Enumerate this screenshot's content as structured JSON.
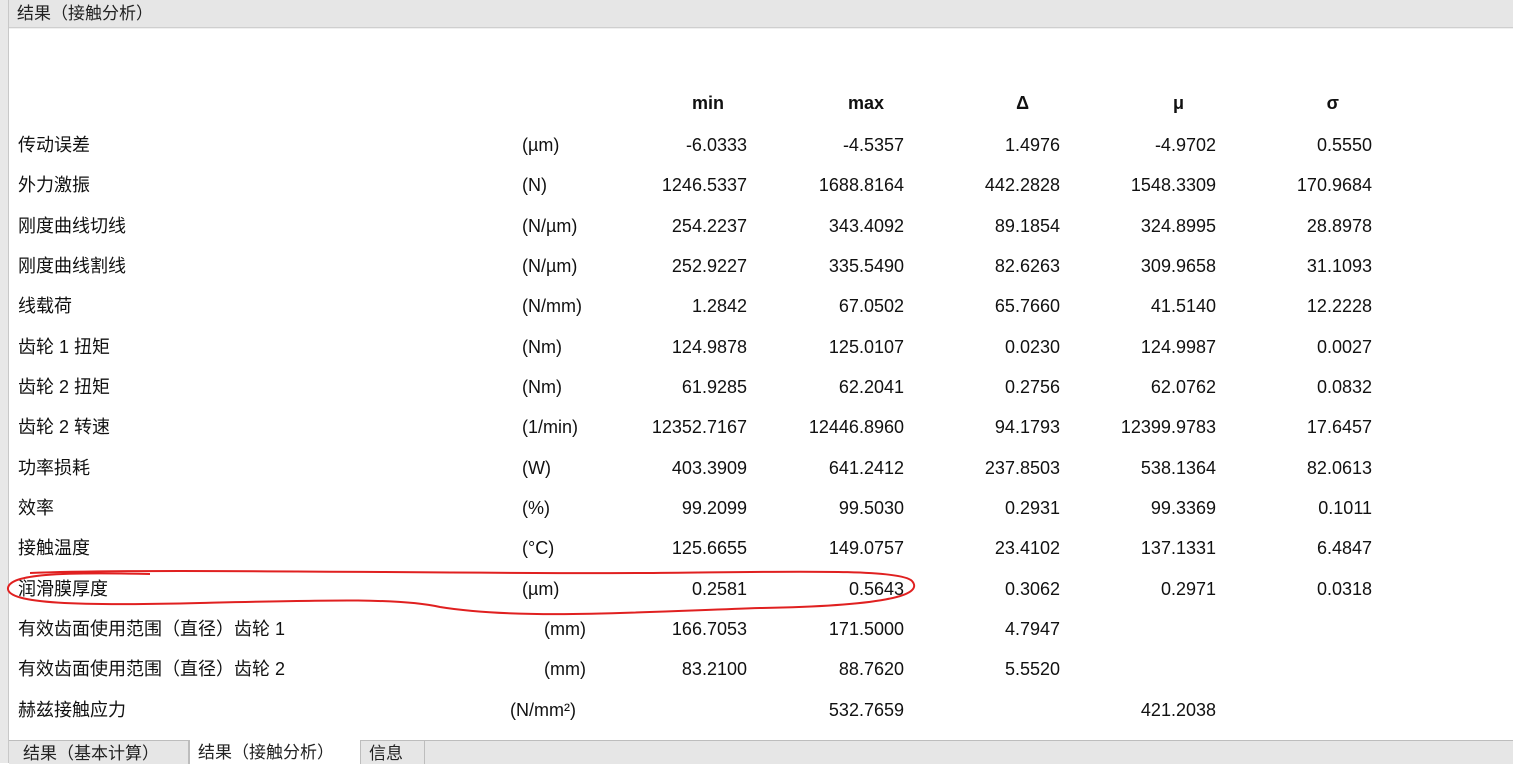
{
  "window": {
    "title": "结果（接触分析）"
  },
  "table": {
    "headers": {
      "min": "min",
      "max": "max",
      "delta": "Δ",
      "mu": "μ",
      "sigma": "σ"
    },
    "rows": [
      {
        "name": "传动误差",
        "unit": "(µm)",
        "min": "-6.0333",
        "max": "-4.5357",
        "delta": "1.4976",
        "mu": "-4.9702",
        "sigma": "0.5550"
      },
      {
        "name": "外力激振",
        "unit": "(N)",
        "min": "1246.5337",
        "max": "1688.8164",
        "delta": "442.2828",
        "mu": "1548.3309",
        "sigma": "170.9684"
      },
      {
        "name": "刚度曲线切线",
        "unit": "(N/µm)",
        "min": "254.2237",
        "max": "343.4092",
        "delta": "89.1854",
        "mu": "324.8995",
        "sigma": "28.8978"
      },
      {
        "name": "刚度曲线割线",
        "unit": "(N/µm)",
        "min": "252.9227",
        "max": "335.5490",
        "delta": "82.6263",
        "mu": "309.9658",
        "sigma": "31.1093"
      },
      {
        "name": "线载荷",
        "unit": "(N/mm)",
        "min": "1.2842",
        "max": "67.0502",
        "delta": "65.7660",
        "mu": "41.5140",
        "sigma": "12.2228"
      },
      {
        "name": "齿轮 1 扭矩",
        "unit": "(Nm)",
        "min": "124.9878",
        "max": "125.0107",
        "delta": "0.0230",
        "mu": "124.9987",
        "sigma": "0.0027"
      },
      {
        "name": "齿轮 2 扭矩",
        "unit": "(Nm)",
        "min": "61.9285",
        "max": "62.2041",
        "delta": "0.2756",
        "mu": "62.0762",
        "sigma": "0.0832"
      },
      {
        "name": "齿轮 2 转速",
        "unit": "(1/min)",
        "min": "12352.7167",
        "max": "12446.8960",
        "delta": "94.1793",
        "mu": "12399.9783",
        "sigma": "17.6457"
      },
      {
        "name": "功率损耗",
        "unit": "(W)",
        "min": "403.3909",
        "max": "641.2412",
        "delta": "237.8503",
        "mu": "538.1364",
        "sigma": "82.0613"
      },
      {
        "name": "效率",
        "unit": "(%)",
        "min": "99.2099",
        "max": "99.5030",
        "delta": "0.2931",
        "mu": "99.3369",
        "sigma": "0.1011"
      },
      {
        "name": "接触温度",
        "unit": "(°C)",
        "min": "125.6655",
        "max": "149.0757",
        "delta": "23.4102",
        "mu": "137.1331",
        "sigma": "6.4847"
      },
      {
        "name": "润滑膜厚度",
        "unit": "(µm)",
        "min": "0.2581",
        "max": "0.5643",
        "delta": "0.3062",
        "mu": "0.2971",
        "sigma": "0.0318"
      },
      {
        "name": "有效齿面使用范围（直径）齿轮 1",
        "unit": "(mm)",
        "min": "166.7053",
        "max": "171.5000",
        "delta": "4.7947",
        "mu": "",
        "sigma": ""
      },
      {
        "name": "有效齿面使用范围（直径）齿轮 2",
        "unit": "(mm)",
        "min": "83.2100",
        "max": "88.7620",
        "delta": "5.5520",
        "mu": "",
        "sigma": ""
      },
      {
        "name": "赫兹接触应力",
        "unit": "(N/mm²)",
        "min": "",
        "max": "532.7659",
        "delta": "",
        "mu": "421.2038",
        "sigma": ""
      }
    ]
  },
  "tabs": [
    {
      "label": "结果（基本计算）",
      "active": false
    },
    {
      "label": "结果（接触分析）",
      "active": true
    },
    {
      "label": "信息",
      "active": false
    }
  ],
  "highlight": {
    "color": "#e02020",
    "row": "润滑膜厚度"
  }
}
